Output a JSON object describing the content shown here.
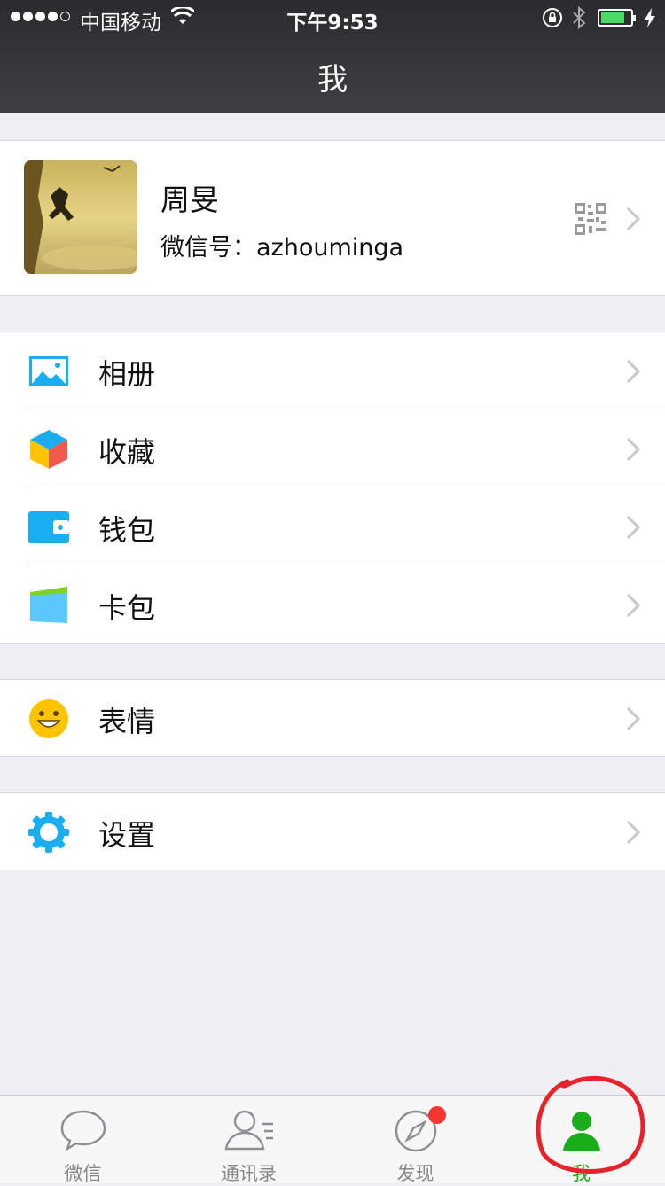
{
  "status": {
    "carrier": "中国移动",
    "time": "下午9:53"
  },
  "nav": {
    "title": "我"
  },
  "profile": {
    "name": "周旻",
    "wechat_id": "微信号：azhouminga"
  },
  "menu_group_1": [
    {
      "label": "相册",
      "icon": "photo-album-icon"
    },
    {
      "label": "收藏",
      "icon": "favorites-cube-icon"
    },
    {
      "label": "钱包",
      "icon": "wallet-icon"
    },
    {
      "label": "卡包",
      "icon": "card-wallet-icon"
    }
  ],
  "menu_group_2": [
    {
      "label": "表情",
      "icon": "smiley-icon"
    }
  ],
  "menu_group_3": [
    {
      "label": "设置",
      "icon": "settings-gear-icon"
    }
  ],
  "tabbar": [
    {
      "label": "微信",
      "icon": "chat-bubble-icon"
    },
    {
      "label": "通讯录",
      "icon": "contacts-icon"
    },
    {
      "label": "发现",
      "icon": "compass-icon"
    },
    {
      "label": "我",
      "icon": "me-person-icon",
      "active": true
    }
  ],
  "colors": {
    "active_green": "#1aad19",
    "badge_red": "#f43530",
    "icon_blue": "#1aadf0",
    "annotation_red": "#e8222a"
  }
}
